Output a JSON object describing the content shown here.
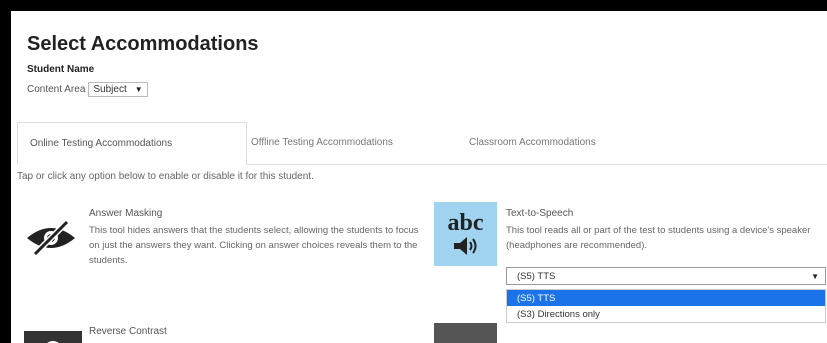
{
  "page": {
    "title": "Select Accommodations",
    "student_label": "Student Name",
    "content_area_label": "Content Area",
    "content_area_value": "Subject"
  },
  "tabs": [
    {
      "label": "Online Testing Accommodations",
      "active": true
    },
    {
      "label": "Offline Testing Accommodations",
      "active": false
    },
    {
      "label": "Classroom Accommodations",
      "active": false
    }
  ],
  "hint": "Tap or click any option below to enable or disable it for this student.",
  "accommodations": {
    "answer_masking": {
      "title": "Answer Masking",
      "description": "This tool hides answers that the students select, allowing the students to focus on just the answers they want. Clicking on answer choices reveals them to the students.",
      "icon": "eye-slash-icon"
    },
    "text_to_speech": {
      "title": "Text-to-Speech",
      "description": "This tool reads all or part of the test to students using a device's speaker (headphones are recommended).",
      "icon_text": "abc",
      "icon": "speaker-icon",
      "selected_value": "(S5) TTS",
      "options": [
        "(S5) TTS",
        "(S3) Directions only"
      ]
    },
    "reverse_contrast": {
      "title": "Reverse Contrast",
      "icon": "contrast-icon"
    }
  },
  "colors": {
    "highlight": "#1a73e8",
    "tts_icon_bg": "#9fd3f0",
    "dark_icon": "#222222"
  }
}
